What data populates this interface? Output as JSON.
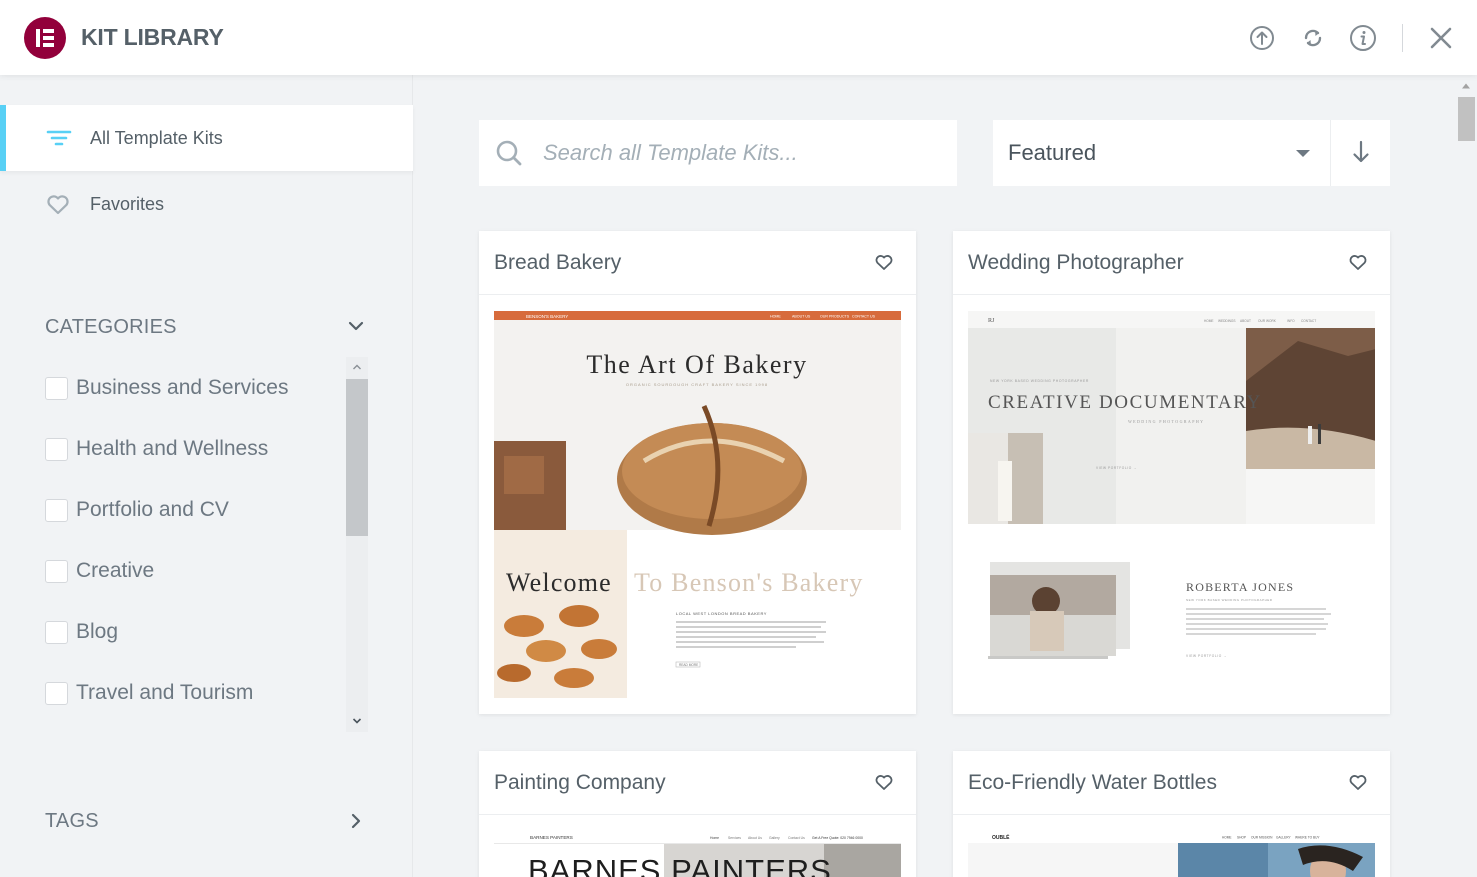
{
  "header": {
    "title": "KIT LIBRARY",
    "icons": [
      "upload-icon",
      "sync-icon",
      "info-icon",
      "close-icon"
    ]
  },
  "sidebar": {
    "nav": [
      {
        "label": "All Template Kits",
        "icon": "filter-lines-icon",
        "active": true
      },
      {
        "label": "Favorites",
        "icon": "heart-icon",
        "active": false
      }
    ],
    "categories_title": "CATEGORIES",
    "categories": [
      {
        "label": "Business and Services",
        "checked": false
      },
      {
        "label": "Health and Wellness",
        "checked": false
      },
      {
        "label": "Portfolio and CV",
        "checked": false
      },
      {
        "label": "Creative",
        "checked": false
      },
      {
        "label": "Blog",
        "checked": false
      },
      {
        "label": "Travel and Tourism",
        "checked": false
      }
    ],
    "tags_title": "TAGS"
  },
  "main": {
    "search": {
      "placeholder": "Search all Template Kits..."
    },
    "sort": {
      "selected": "Featured"
    },
    "kits": [
      {
        "title": "Bread Bakery",
        "preview": {
          "brand": "BENSON'S BAKERY",
          "nav": [
            "HOME",
            "ABOUT US",
            "OUR PRODUCTS",
            "CONTACT US"
          ],
          "headline": "The Art Of Bakery",
          "subline": "ORGANIC SOURDOUGH CRAFT BAKERY SINCE 1998",
          "welcome_a": "Welcome",
          "welcome_b": "To Benson's Bakery",
          "kicker": "LOCAL WEST LONDON BREAD BAKERY",
          "cta": "READ MORE"
        }
      },
      {
        "title": "Wedding Photographer",
        "preview": {
          "logo": "RJ",
          "nav": [
            "HOME",
            "WEDDINGS",
            "ABOUT",
            "OUR WORK",
            "INFO",
            "CONTACT"
          ],
          "eyebrow": "NEW YORK BASED WEDDING PHOTOGRAPHER",
          "headline": "CREATIVE DOCUMENTARY",
          "subline": "WEDDING PHOTOGRAPHY",
          "link": "VIEW PORTFOLIO →",
          "name": "ROBERTA JONES",
          "name_sub": "NEW YORK BASED WEDDING PHOTOGRAPHER",
          "link2": "VIEW PORTFOLIO →"
        }
      },
      {
        "title": "Painting Company",
        "preview": {
          "brand": "BARNES PAINTERS",
          "nav": [
            "Home",
            "Services",
            "About Us",
            "Gallery",
            "Contact Us"
          ],
          "phone": "Get A Free Quote: 020 7946 0000",
          "headline": "BARNES PAINTERS"
        }
      },
      {
        "title": "Eco-Friendly Water Bottles",
        "preview": {
          "brand": "OUBLÉ",
          "nav": [
            "HOME",
            "SHOP",
            "OUR MISSION",
            "GALLERY",
            "WHERE TO BUY"
          ]
        }
      }
    ]
  },
  "colors": {
    "brand": "#92003b",
    "accent": "#58d0f5",
    "text": "#556068",
    "muted": "#6d7882",
    "background": "#f1f3f5"
  }
}
